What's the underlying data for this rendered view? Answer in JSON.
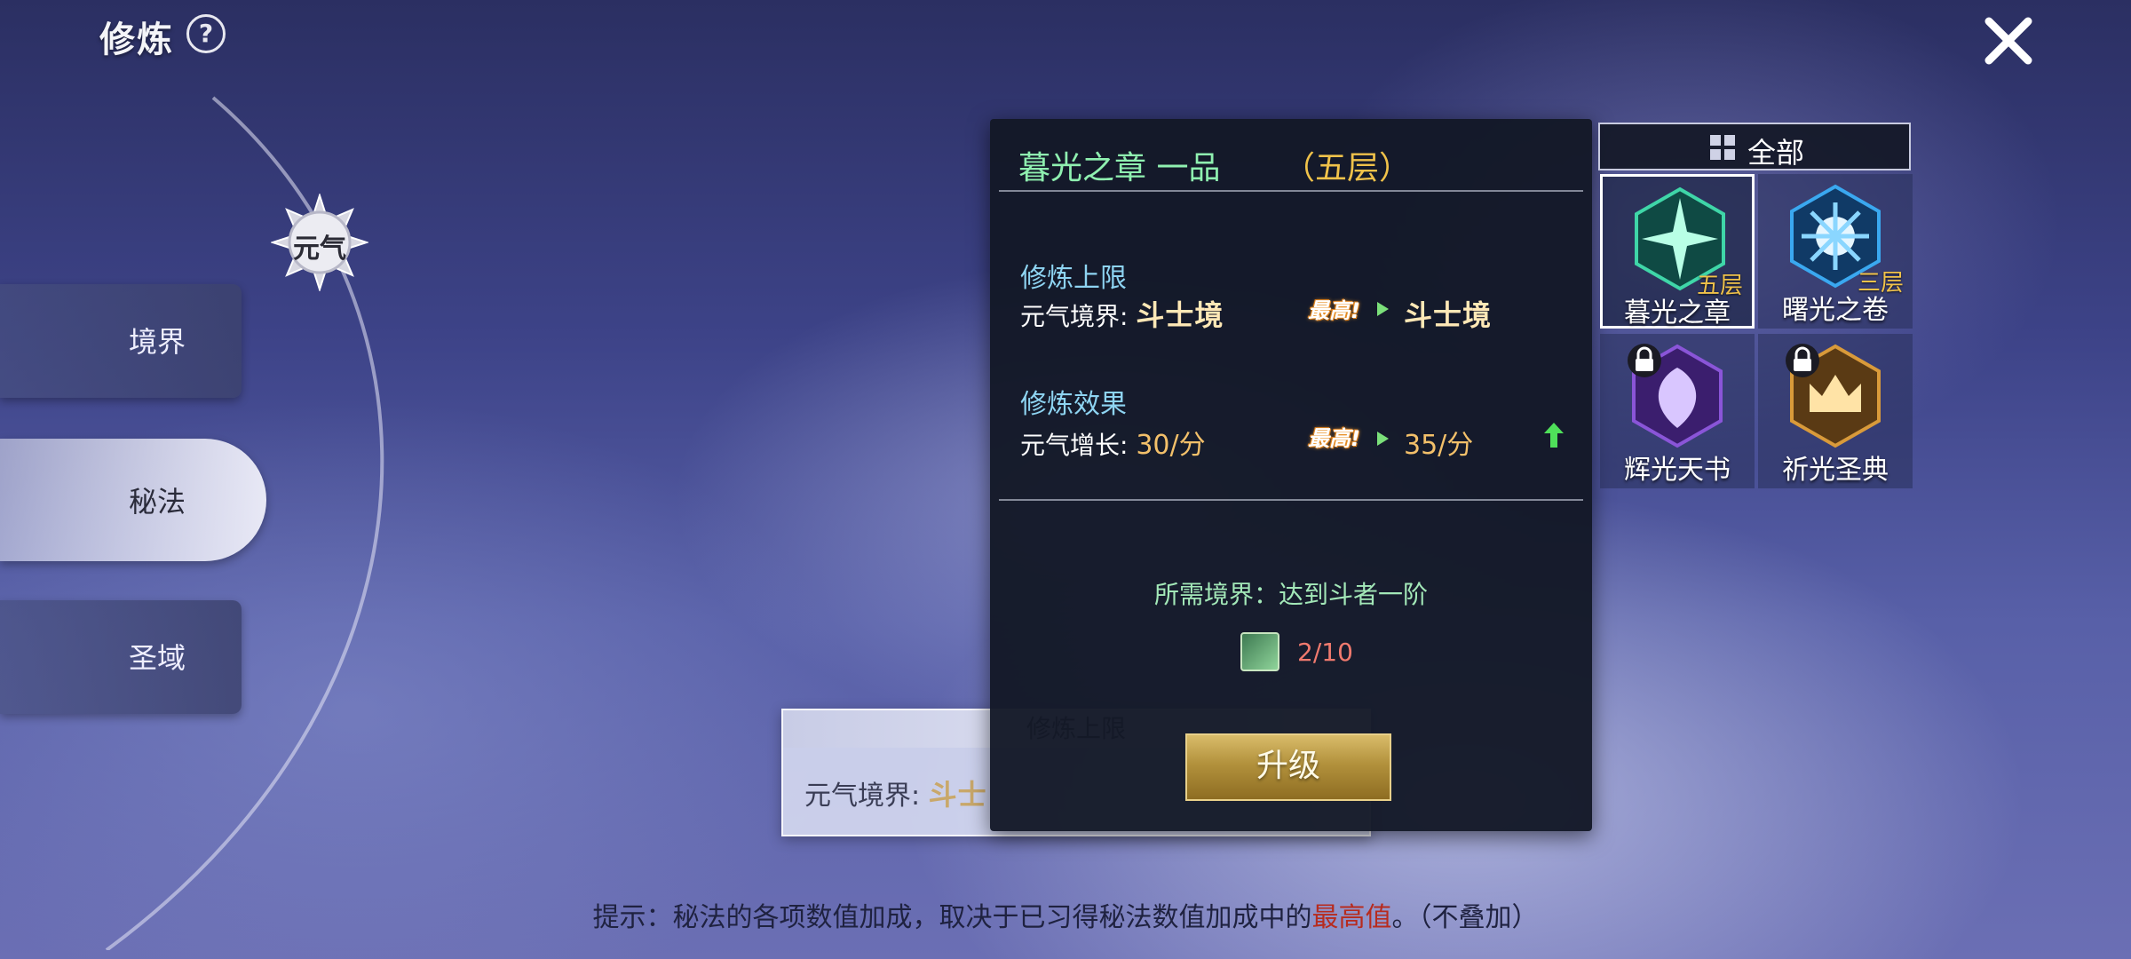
{
  "header": {
    "title": "修炼",
    "help_icon": "question-icon",
    "close_icon": "close-icon"
  },
  "yuanqi_badge": "元气",
  "side_tabs": [
    {
      "label": "境界"
    },
    {
      "label": "秘法",
      "selected": true
    },
    {
      "label": "圣域"
    }
  ],
  "bg_card": {
    "title": "修炼上限",
    "label": "元气境界:",
    "value": "斗士"
  },
  "panel": {
    "title": "暮光之章 一品",
    "level": "（五层）",
    "section1": {
      "title": "修炼上限",
      "label": "元气境界:",
      "current": "斗士境",
      "max_badge": "最高!",
      "next": "斗士境"
    },
    "section2": {
      "title": "修炼效果",
      "label": "元气增长:",
      "current": "30/分",
      "max_badge": "最高!",
      "next": "35/分"
    },
    "requirement": "所需境界：达到斗者一阶",
    "item_count": "2/10",
    "upgrade_label": "升级"
  },
  "category": {
    "all_label": "全部",
    "items": [
      {
        "name": "暮光之章",
        "tier": "五层",
        "selected": true,
        "locked": false,
        "color": "#2fbf8f"
      },
      {
        "name": "曙光之卷",
        "tier": "三层",
        "selected": false,
        "locked": false,
        "color": "#3aa8f0"
      },
      {
        "name": "辉光天书",
        "tier": "",
        "selected": false,
        "locked": true,
        "color": "#8a55d8"
      },
      {
        "name": "祈光圣典",
        "tier": "",
        "selected": false,
        "locked": true,
        "color": "#d99a3a"
      }
    ]
  },
  "tip": {
    "prefix": "提示：秘法的各项数值加成，取决于已习得秘法数值加成中的",
    "highlight": "最高值",
    "suffix": "。（不叠加）"
  }
}
